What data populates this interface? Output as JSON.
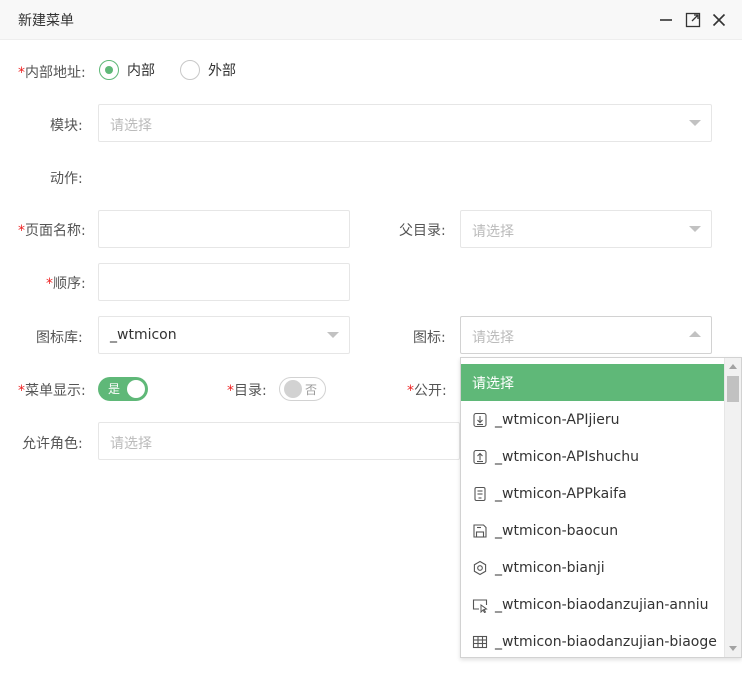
{
  "dialog": {
    "title": "新建菜单"
  },
  "window": {
    "minimize_icon": "minimize-icon",
    "maximize_icon": "maximize-icon",
    "close_icon": "close-icon"
  },
  "form": {
    "address": {
      "required": "*",
      "label": "内部地址:",
      "options": [
        {
          "label": "内部",
          "checked": true
        },
        {
          "label": "外部",
          "checked": false
        }
      ]
    },
    "module": {
      "label": "模块:",
      "placeholder": "请选择"
    },
    "action": {
      "label": "动作:"
    },
    "page_name": {
      "required": "*",
      "label": "页面名称:",
      "value": ""
    },
    "parent": {
      "label": "父目录:",
      "placeholder": "请选择"
    },
    "order": {
      "required": "*",
      "label": "顺序:",
      "value": ""
    },
    "icon_lib": {
      "label": "图标库:",
      "value": "_wtmicon"
    },
    "icon": {
      "label": "图标:",
      "placeholder": "请选择"
    },
    "menu_show": {
      "required": "*",
      "label": "菜单显示:",
      "state": "是",
      "on": true
    },
    "directory": {
      "required": "*",
      "label": "目录:",
      "state": "否",
      "on": false
    },
    "public": {
      "required": "*",
      "label": "公开:"
    },
    "roles": {
      "label": "允许角色:",
      "placeholder": "请选择"
    }
  },
  "icon_dropdown": {
    "selected": "请选择",
    "items": [
      {
        "label": "_wtmicon-APIjieru",
        "icon": "api-import-icon"
      },
      {
        "label": "_wtmicon-APIshuchu",
        "icon": "api-export-icon"
      },
      {
        "label": "_wtmicon-APPkaifa",
        "icon": "app-dev-icon"
      },
      {
        "label": "_wtmicon-baocun",
        "icon": "save-icon"
      },
      {
        "label": "_wtmicon-bianji",
        "icon": "edit-icon"
      },
      {
        "label": "_wtmicon-biaodanzujian-anniu",
        "icon": "form-button-icon"
      },
      {
        "label": "_wtmicon-biaodanzujian-biaoge",
        "icon": "table-icon"
      }
    ]
  },
  "colors": {
    "accent": "#5fb878",
    "required": "#ee2222",
    "border": "#e6e6e6",
    "placeholder": "#bbbbbb"
  }
}
